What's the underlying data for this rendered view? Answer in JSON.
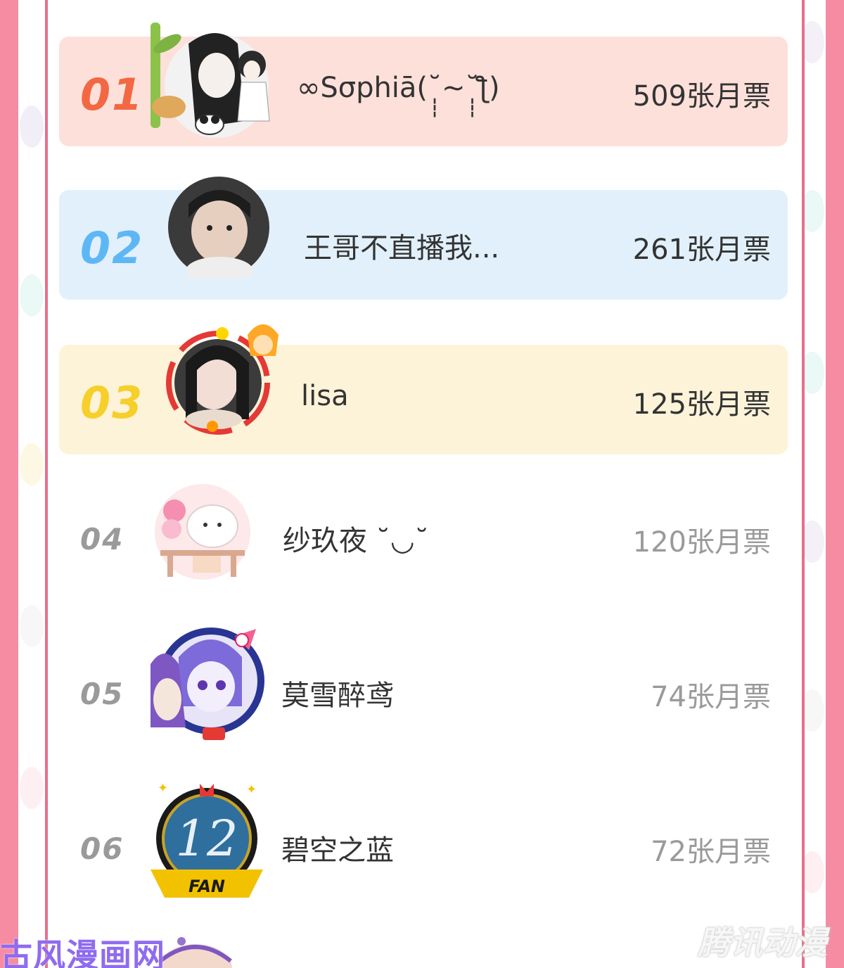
{
  "ranking": [
    {
      "rank": "01",
      "name": "∞Sσphiā(˘̩̩̩~˘̩̩̩ƪ)",
      "votes": "509张月票",
      "color": "#f26842"
    },
    {
      "rank": "02",
      "name": "王哥不直播我...",
      "votes": "261张月票",
      "color": "#5eb7f5"
    },
    {
      "rank": "03",
      "name": "lisa",
      "votes": "125张月票",
      "color": "#f6cf2a"
    },
    {
      "rank": "04",
      "name": "纱玖夜 ˘◡˘",
      "votes": "120张月票",
      "color": "#9a9a9a"
    },
    {
      "rank": "05",
      "name": "莫雪醉鸢",
      "votes": "74张月票",
      "color": "#9a9a9a"
    },
    {
      "rank": "06",
      "name": "碧空之蓝",
      "votes": "72张月票",
      "color": "#9a9a9a"
    }
  ],
  "avatar_badges": {
    "fan_badge_number": "12",
    "fan_badge_label": "FAN"
  },
  "watermarks": {
    "left": "古风漫画网",
    "right": "腾讯动漫"
  }
}
